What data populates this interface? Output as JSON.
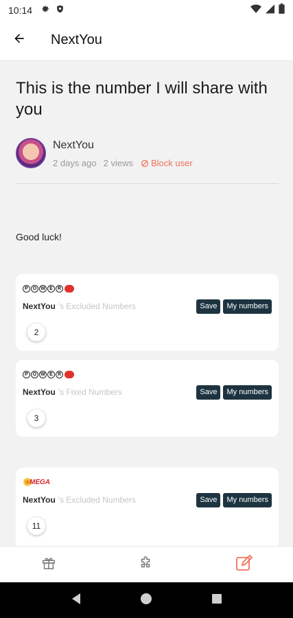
{
  "status_bar": {
    "time": "10:14"
  },
  "app_bar": {
    "title": "NextYou"
  },
  "post": {
    "title": "This is the number I will share with you",
    "author": "NextYou",
    "posted": "2 days ago",
    "views": "2 views",
    "block_label": "Block user",
    "body": "Good luck!"
  },
  "cards": [
    {
      "lottery_logo": "powerball-logo",
      "owner": "NextYou",
      "label": "'s Excluded Numbers",
      "save_label": "Save",
      "my_numbers_label": "My numbers",
      "numbers": [
        "2"
      ]
    },
    {
      "lottery_logo": "powerball-logo",
      "owner": "NextYou",
      "label": "'s Fixed Numbers",
      "save_label": "Save",
      "my_numbers_label": "My numbers",
      "numbers": [
        "3"
      ]
    },
    {
      "lottery_logo": "mega-millions-logo",
      "owner": "NextYou",
      "label": "'s Excluded Numbers",
      "save_label": "Save",
      "my_numbers_label": "My numbers",
      "numbers": [
        "11"
      ]
    }
  ],
  "bottom_nav": {
    "items": [
      "gift-icon",
      "puzzle-icon",
      "edit-icon"
    ],
    "active": "edit-icon"
  },
  "colors": {
    "accent": "#f0705a",
    "button_dark": "#1d3440",
    "background": "#f2f2f2"
  }
}
